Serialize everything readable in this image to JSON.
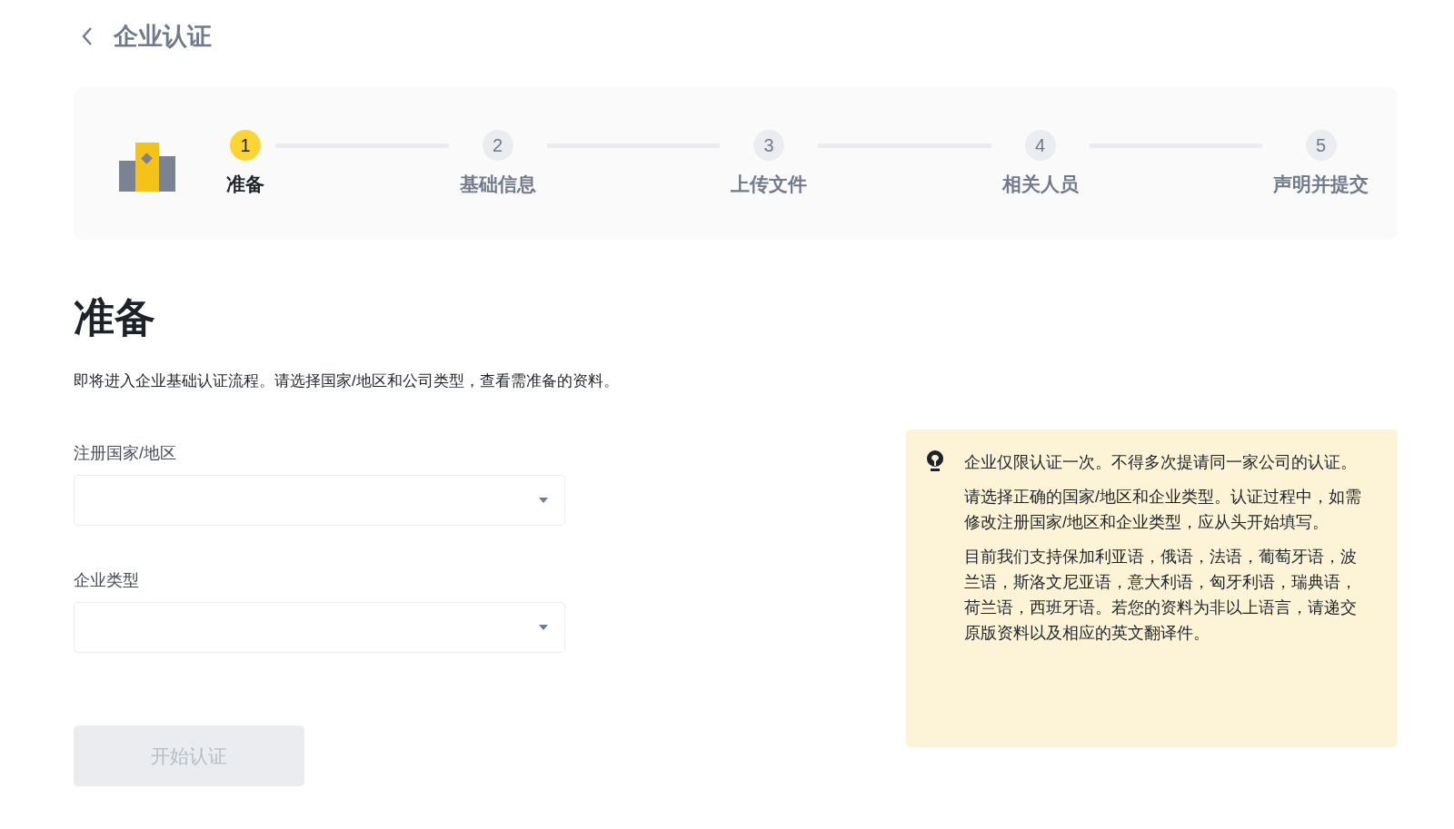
{
  "header": {
    "title": "企业认证"
  },
  "steps": [
    {
      "number": "1",
      "label": "准备",
      "selected": true
    },
    {
      "number": "2",
      "label": "基础信息",
      "selected": false
    },
    {
      "number": "3",
      "label": "上传文件",
      "selected": false
    },
    {
      "number": "4",
      "label": "相关人员",
      "selected": false
    },
    {
      "number": "5",
      "label": "声明并提交",
      "selected": false
    }
  ],
  "section": {
    "title": "准备",
    "description": "即将进入企业基础认证流程。请选择国家/地区和公司类型，查看需准备的资料。"
  },
  "fields": [
    {
      "label": "注册国家/地区"
    },
    {
      "label": "企业类型"
    }
  ],
  "button": {
    "label": "开始认证",
    "disabled": true
  },
  "tip": {
    "paragraphs": [
      "企业仅限认证一次。不得多次提请同一家公司的认证。",
      "请选择正确的国家/地区和企业类型。认证过程中，如需修改注册国家/地区和企业类型，应从头开始填写。",
      "目前我们支持保加利亚语，俄语，法语，葡萄牙语，波兰语，斯洛文尼亚语，意大利语，匈牙利语，瑞典语，荷兰语，西班牙语。若您的资料为非以上语言，请递交原版资料以及相应的英文翻译件。"
    ]
  }
}
